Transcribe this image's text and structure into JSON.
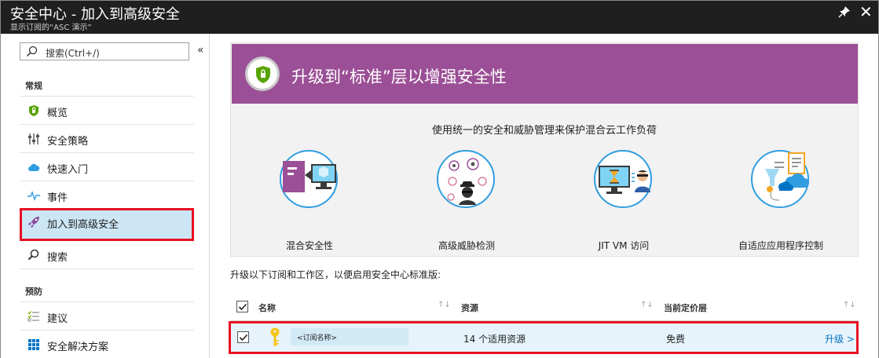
{
  "titlebar": {
    "title": "安全中心 - 加入到高级安全",
    "subtitle": "显示订阅的“ASC 演示”",
    "pin_icon": "pin-icon",
    "close_label": "✕"
  },
  "sidebar": {
    "search_placeholder": "搜索(Ctrl+/)",
    "collapse_label": "«",
    "sections": [
      {
        "label": "常规",
        "items": [
          {
            "label": "概览",
            "icon": "shield-icon"
          },
          {
            "label": "安全策略",
            "icon": "policy-sliders-icon"
          },
          {
            "label": "快速入门",
            "icon": "cloud-icon"
          },
          {
            "label": "事件",
            "icon": "pulse-icon"
          },
          {
            "label": "加入到高级安全",
            "icon": "rocket-icon",
            "active": true
          },
          {
            "label": "搜索",
            "icon": "search-icon"
          }
        ]
      },
      {
        "label": "预防",
        "items": [
          {
            "label": "建议",
            "icon": "checklist-icon"
          },
          {
            "label": "安全解决方案",
            "icon": "grid-icon"
          }
        ]
      }
    ]
  },
  "main": {
    "banner_headline": "升级到“标准”层以增强安全性",
    "description": "使用统一的安全和威胁管理来保护混合云工作负荷",
    "features": [
      {
        "label": "混合安全性",
        "icon": "hybrid-security-icon"
      },
      {
        "label": "高级威胁检测",
        "icon": "threat-detection-icon"
      },
      {
        "label": "JIT VM 访问",
        "icon": "jit-vm-icon"
      },
      {
        "label": "自适应应用程序控制",
        "icon": "adaptive-app-icon"
      }
    ],
    "upgrade_note": "升级以下订阅和工作区，以便启用安全中心标准版:",
    "table": {
      "headers": [
        "名称",
        "资源",
        "当前定价层"
      ],
      "sort_glyph": "↑↓",
      "rows": [
        {
          "name": "<订阅名称>",
          "resources": "14 个适用资源",
          "tier": "免费",
          "action": "升级 >",
          "checked": true
        }
      ]
    }
  },
  "colors": {
    "banner": "#9b4f96",
    "highlight_border": "#e81123",
    "selected_bg": "#cce6f5",
    "link": "#0072c6",
    "accent_blue": "#2f9de0"
  }
}
